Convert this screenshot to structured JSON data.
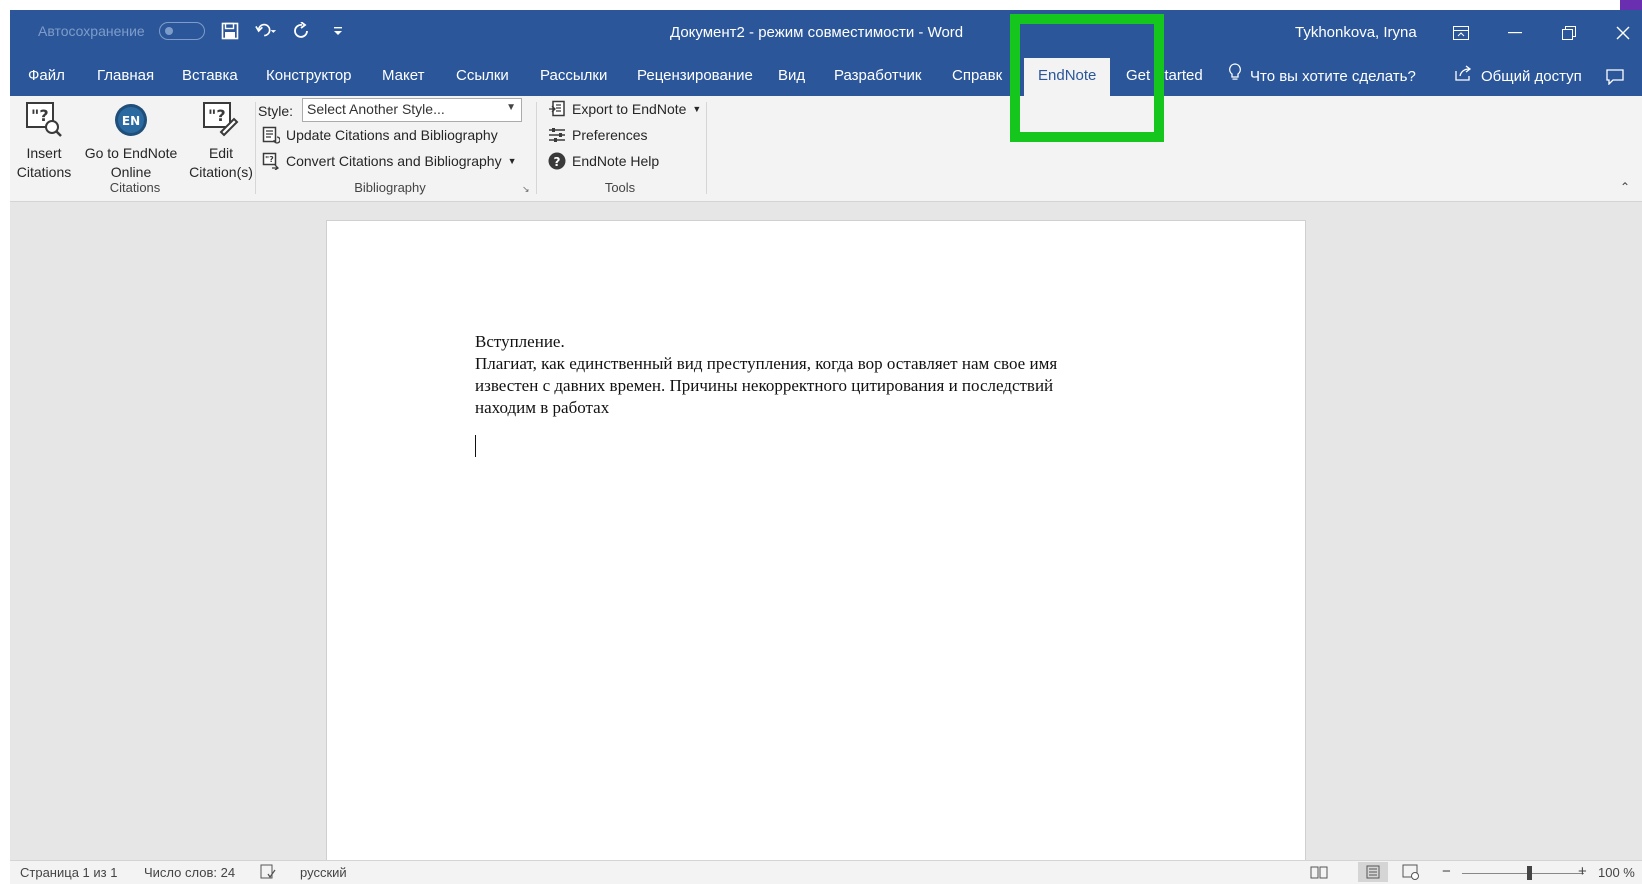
{
  "titlebar": {
    "autosave_label": "Автосохранение",
    "doc_title": "Документ2 - режим совместимости - Word",
    "user_name": "Tykhonkova, Iryna"
  },
  "tabs": [
    {
      "label": "Файл"
    },
    {
      "label": "Главная"
    },
    {
      "label": "Вставка"
    },
    {
      "label": "Конструктор"
    },
    {
      "label": "Макет"
    },
    {
      "label": "Ссылки"
    },
    {
      "label": "Рассылки"
    },
    {
      "label": "Рецензирование"
    },
    {
      "label": "Вид"
    },
    {
      "label": "Разработчик"
    },
    {
      "label": "Справк"
    },
    {
      "label": "EndNote",
      "active": true
    },
    {
      "label": "Get Started"
    }
  ],
  "tellme": {
    "label": "Что вы хотите сделать?"
  },
  "share": {
    "label": "Общий доступ"
  },
  "ribbon": {
    "citations": {
      "group_label": "Citations",
      "insert_citations": "Insert\nCitations",
      "insert_line1": "Insert",
      "insert_line2": "Citations",
      "goto_line1": "Go to EndNote",
      "goto_line2": "Online",
      "goto_badge": "EN",
      "edit_line1": "Edit",
      "edit_line2": "Citation(s)"
    },
    "bibliography": {
      "group_label": "Bibliography",
      "style_label": "Style:",
      "style_value": "Select Another Style...",
      "update_label": "Update Citations and Bibliography",
      "convert_label": "Convert Citations and Bibliography"
    },
    "tools": {
      "group_label": "Tools",
      "export_label": "Export to EndNote",
      "preferences_label": "Preferences",
      "help_label": "EndNote Help"
    }
  },
  "document": {
    "heading": "Вступление.",
    "paragraph_line1": "Плагиат, как единственный вид преступления, когда вор оставляет нам свое имя",
    "paragraph_line2": "известен с давних времен. Причины некорректного цитирования и последствий",
    "paragraph_line3": "находим в работах"
  },
  "statusbar": {
    "page": "Страница 1 из 1",
    "words": "Число слов: 24",
    "language": "русский",
    "zoom": "100 %",
    "zoom_fraction": 0.55
  },
  "colors": {
    "title_blue": "#2b579a",
    "highlight_green": "#15c61d"
  }
}
